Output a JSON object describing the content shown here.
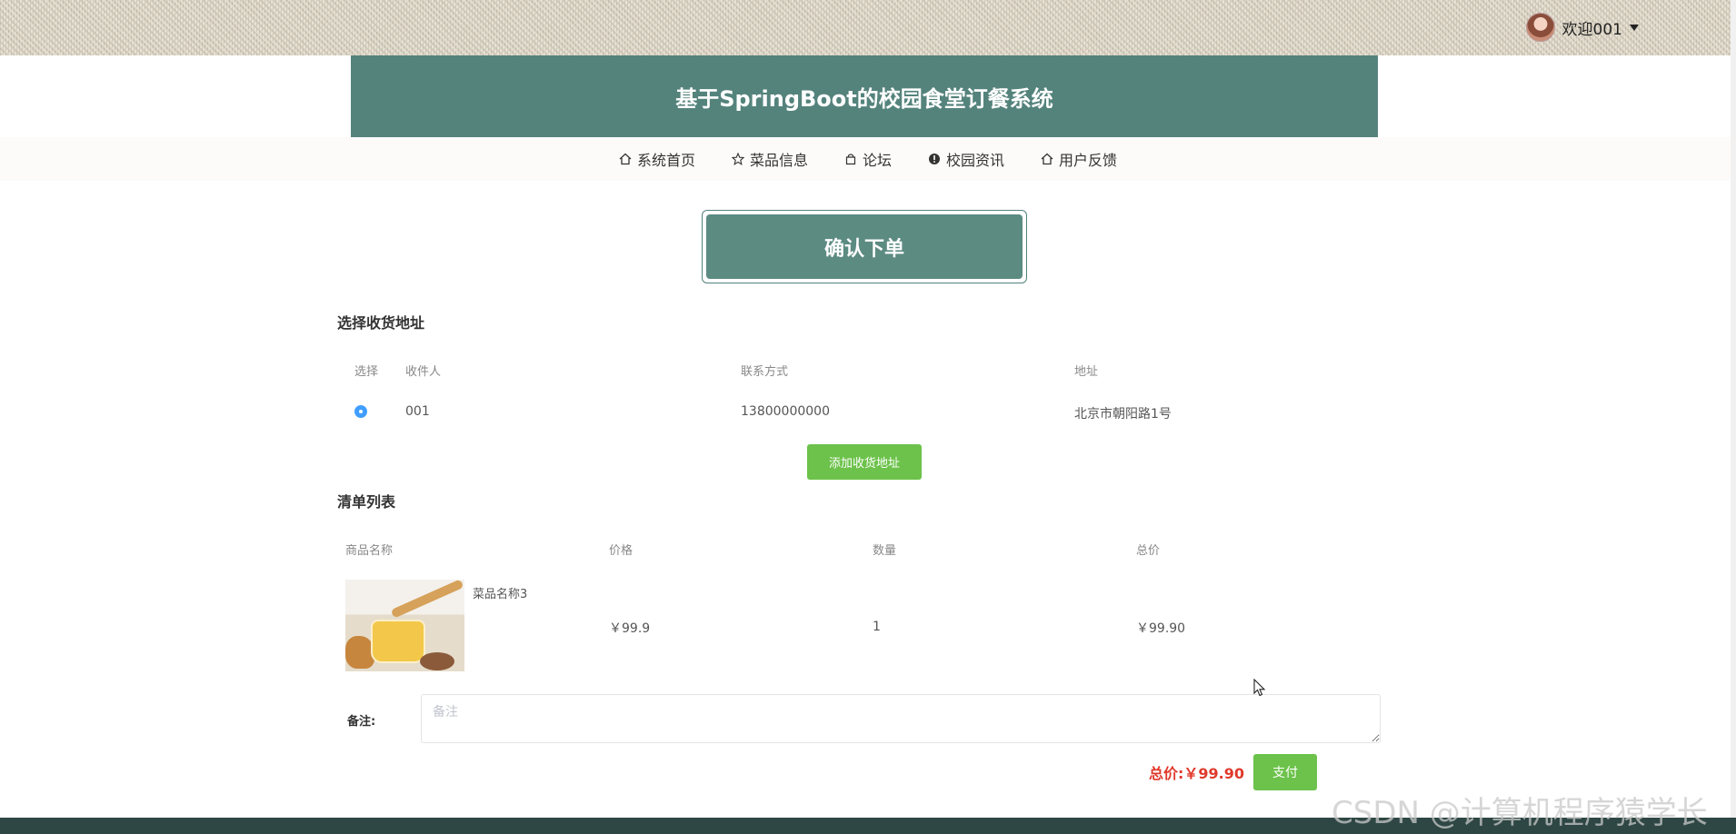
{
  "header": {
    "user_greeting": "欢迎001"
  },
  "banner": {
    "title": "基于SpringBoot的校园食堂订餐系统"
  },
  "nav": {
    "items": [
      {
        "label": "系统首页",
        "icon": "home-icon"
      },
      {
        "label": "菜品信息",
        "icon": "star-icon"
      },
      {
        "label": "论坛",
        "icon": "bag-icon"
      },
      {
        "label": "校园资讯",
        "icon": "info-icon"
      },
      {
        "label": "用户反馈",
        "icon": "home-icon"
      }
    ]
  },
  "page": {
    "title": "确认下单"
  },
  "address": {
    "section_title": "选择收货地址",
    "headers": [
      "选择",
      "收件人",
      "联系方式",
      "地址"
    ],
    "rows": [
      {
        "receiver": "001",
        "phone": "13800000000",
        "address": "北京市朝阳路1号",
        "selected": true
      }
    ],
    "add_button": "添加收货地址"
  },
  "order": {
    "section_title": "清单列表",
    "headers": [
      "商品名称",
      "价格",
      "数量",
      "总价"
    ],
    "items": [
      {
        "name": "菜品名称3",
        "price": "￥99.9",
        "quantity": "1",
        "total": "￥99.90"
      }
    ]
  },
  "remark": {
    "label": "备注:",
    "placeholder": "备注",
    "value": ""
  },
  "summary": {
    "total_label": "总价:",
    "total_value": "￥99.90",
    "pay_button": "支付"
  },
  "watermark": "CSDN @计算机程序猿学长",
  "colors": {
    "banner": "#54837c",
    "accent_green": "#6cc24a",
    "price_red": "#e0392b",
    "radio_blue": "#409eff",
    "footer": "#2e4744"
  }
}
